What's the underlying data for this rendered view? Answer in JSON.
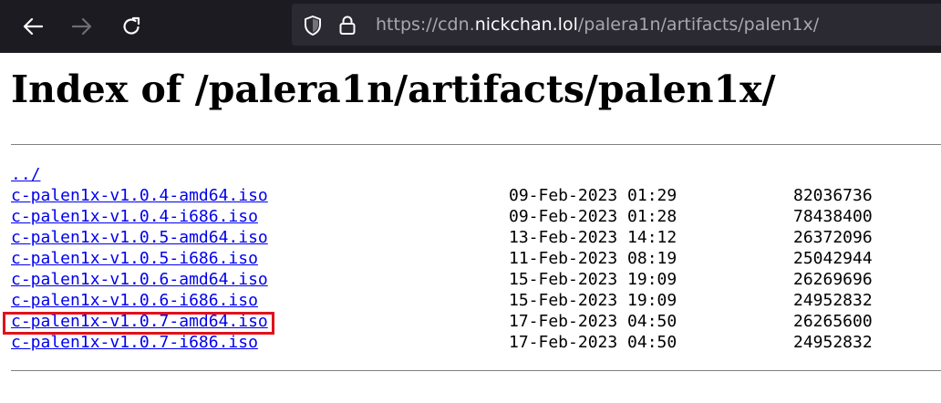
{
  "browser": {
    "url_prefix": "https://cdn.",
    "url_host": "nickchan.lol",
    "url_path": "/palera1n/artifacts/palen1x/"
  },
  "page": {
    "title": "Index of /palera1n/artifacts/palen1x/",
    "parent_link": "../",
    "files": [
      {
        "name": "c-palen1x-v1.0.4-amd64.iso",
        "date": "09-Feb-2023 01:29",
        "size": "82036736"
      },
      {
        "name": "c-palen1x-v1.0.4-i686.iso",
        "date": "09-Feb-2023 01:28",
        "size": "78438400"
      },
      {
        "name": "c-palen1x-v1.0.5-amd64.iso",
        "date": "13-Feb-2023 14:12",
        "size": "26372096"
      },
      {
        "name": "c-palen1x-v1.0.5-i686.iso",
        "date": "11-Feb-2023 08:19",
        "size": "25042944"
      },
      {
        "name": "c-palen1x-v1.0.6-amd64.iso",
        "date": "15-Feb-2023 19:09",
        "size": "26269696"
      },
      {
        "name": "c-palen1x-v1.0.6-i686.iso",
        "date": "15-Feb-2023 19:09",
        "size": "24952832"
      },
      {
        "name": "c-palen1x-v1.0.7-amd64.iso",
        "date": "17-Feb-2023 04:50",
        "size": "26265600"
      },
      {
        "name": "c-palen1x-v1.0.7-i686.iso",
        "date": "17-Feb-2023 04:50",
        "size": "24952832"
      }
    ]
  },
  "colors": {
    "toolbar_bg": "#1c1b22",
    "urlbar_bg": "#2b2a33",
    "link": "#0000ee",
    "highlight_box": "#e0121b"
  },
  "icons": [
    "back-arrow-icon",
    "forward-arrow-icon",
    "reload-icon",
    "shield-icon",
    "lock-icon"
  ]
}
